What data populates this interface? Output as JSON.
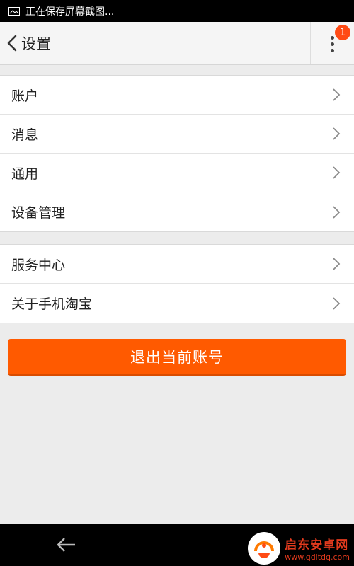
{
  "statusbar": {
    "text": "正在保存屏幕截图..."
  },
  "header": {
    "title": "设置",
    "badge": "1"
  },
  "settings_group1": [
    {
      "label": "账户"
    },
    {
      "label": "消息"
    },
    {
      "label": "通用"
    },
    {
      "label": "设备管理"
    }
  ],
  "settings_group2": [
    {
      "label": "服务中心"
    },
    {
      "label": "关于手机淘宝"
    }
  ],
  "logout": {
    "label": "退出当前账号"
  },
  "watermark": {
    "title": "启东安卓网",
    "url": "www.qdltdq.com"
  },
  "colors": {
    "accent": "#ff5a00",
    "badge": "#ff4a14",
    "background": "#ececec"
  }
}
